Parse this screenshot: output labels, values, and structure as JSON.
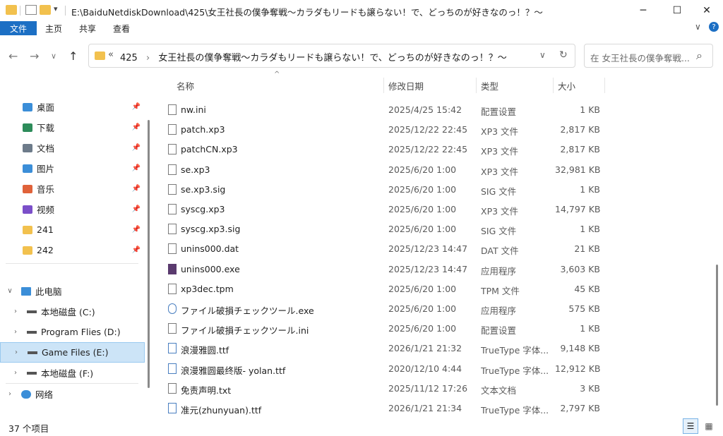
{
  "window": {
    "title": "E:\\BaiduNetdiskDownload\\425\\女王社長の僕争奪戦～カラダもリードも譲らない！で、どっちのが好きなのっ！？～",
    "minimize": "─",
    "maximize": "☐",
    "close": "✕",
    "qa_dropdown": "▾"
  },
  "ribbon": {
    "file": "文件",
    "home": "主页",
    "share": "共享",
    "view": "查看",
    "collapse": "∨",
    "help": "?"
  },
  "nav": {
    "back": "←",
    "forward": "→",
    "recent": "∨",
    "up": "↑"
  },
  "address": {
    "overflow": "«",
    "segments": [
      "425",
      "女王社長の僕争奪戦～カラダもリードも譲らない！で、どっちのが好きなのっ！？～"
    ],
    "separator": "›",
    "dropdown": "∨",
    "refresh": "↻"
  },
  "search": {
    "placeholder": "在 女王社長の僕争奪戦...",
    "icon": "⌕"
  },
  "sidebar": {
    "quick": [
      {
        "label": "桌面",
        "icon": "desktop-icon",
        "color": "#3b8ed8"
      },
      {
        "label": "下载",
        "icon": "download-icon",
        "color": "#2d8c5a"
      },
      {
        "label": "文档",
        "icon": "document-icon",
        "color": "#6d7b8a"
      },
      {
        "label": "图片",
        "icon": "picture-icon",
        "color": "#3b8ed8"
      },
      {
        "label": "音乐",
        "icon": "music-icon",
        "color": "#e0623a"
      },
      {
        "label": "视频",
        "icon": "video-icon",
        "color": "#7b4fc9"
      },
      {
        "label": "241",
        "icon": "folder-icon",
        "color": "#f2c14e"
      },
      {
        "label": "242",
        "icon": "folder-icon",
        "color": "#f2c14e"
      }
    ],
    "pin": "📌",
    "pc": "此电脑",
    "drives": [
      {
        "label": "本地磁盘 (C:)"
      },
      {
        "label": "Program Flies (D:)"
      },
      {
        "label": "Game Files (E:)"
      },
      {
        "label": "本地磁盘 (F:)"
      }
    ],
    "network": "网络",
    "expand": "›",
    "collapse": "∨"
  },
  "columns": {
    "name": "名称",
    "date": "修改日期",
    "type": "类型",
    "size": "大小",
    "sort_indicator": "^"
  },
  "files": [
    {
      "name": "nw.ini",
      "date": "2025/4/25 15:42",
      "type": "配置设置",
      "size": "1 KB",
      "icon": "config-file-icon"
    },
    {
      "name": "patch.xp3",
      "date": "2025/12/22 22:45",
      "type": "XP3 文件",
      "size": "2,817 KB",
      "icon": "file-icon"
    },
    {
      "name": "patchCN.xp3",
      "date": "2025/12/22 22:45",
      "type": "XP3 文件",
      "size": "2,817 KB",
      "icon": "file-icon"
    },
    {
      "name": "se.xp3",
      "date": "2025/6/20 1:00",
      "type": "XP3 文件",
      "size": "32,981 KB",
      "icon": "file-icon"
    },
    {
      "name": "se.xp3.sig",
      "date": "2025/6/20 1:00",
      "type": "SIG 文件",
      "size": "1 KB",
      "icon": "file-icon"
    },
    {
      "name": "syscg.xp3",
      "date": "2025/6/20 1:00",
      "type": "XP3 文件",
      "size": "14,797 KB",
      "icon": "file-icon"
    },
    {
      "name": "syscg.xp3.sig",
      "date": "2025/6/20 1:00",
      "type": "SIG 文件",
      "size": "1 KB",
      "icon": "file-icon"
    },
    {
      "name": "unins000.dat",
      "date": "2025/12/23 14:47",
      "type": "DAT 文件",
      "size": "21 KB",
      "icon": "file-icon"
    },
    {
      "name": "unins000.exe",
      "date": "2025/12/23 14:47",
      "type": "应用程序",
      "size": "3,603 KB",
      "icon": "app-icon"
    },
    {
      "name": "xp3dec.tpm",
      "date": "2025/6/20 1:00",
      "type": "TPM 文件",
      "size": "45 KB",
      "icon": "file-icon"
    },
    {
      "name": "ファイル破損チェックツール.exe",
      "date": "2025/6/20 1:00",
      "type": "应用程序",
      "size": "575 KB",
      "icon": "magnifier-app-icon"
    },
    {
      "name": "ファイル破損チェックツール.ini",
      "date": "2025/6/20 1:00",
      "type": "配置设置",
      "size": "1 KB",
      "icon": "config-file-icon"
    },
    {
      "name": "浪漫雅圆.ttf",
      "date": "2026/1/21 21:32",
      "type": "TrueType 字体...",
      "size": "9,148 KB",
      "icon": "font-file-icon"
    },
    {
      "name": "浪漫雅圆最终版- yolan.ttf",
      "date": "2020/12/10 4:44",
      "type": "TrueType 字体...",
      "size": "12,912 KB",
      "icon": "font-file-icon"
    },
    {
      "name": "免责声明.txt",
      "date": "2025/11/12 17:26",
      "type": "文本文档",
      "size": "3 KB",
      "icon": "text-file-icon"
    },
    {
      "name": "准元(zhunyuan).ttf",
      "date": "2026/1/21 21:34",
      "type": "TrueType 字体...",
      "size": "2,797 KB",
      "icon": "font-file-icon"
    }
  ],
  "status": {
    "count": "37 个项目",
    "details_view": "☰",
    "tiles_view": "▦"
  },
  "colors": {
    "accent": "#1c6fc4",
    "selected": "#cce4f7",
    "folder": "#f2c14e"
  }
}
